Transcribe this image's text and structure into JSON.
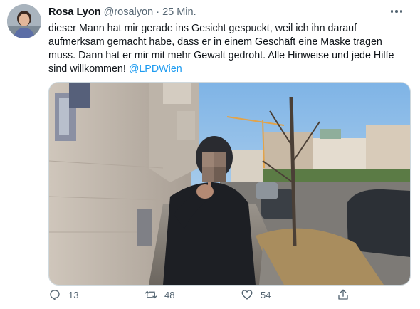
{
  "tweet": {
    "author_name": "Rosa Lyon",
    "handle": "@rosalyon",
    "separator": "·",
    "time": "25 Min.",
    "text": "dieser Mann hat mir gerade ins Gesicht gespuckt, weil ich ihn darauf aufmerksam gemacht habe, dass er in einem Geschäft eine Maske tragen muss. Dann hat er mir mit mehr Gewalt gedroht. Alle Hinweise und jede Hilfe sind willkommen!",
    "mention": "@LPDWien"
  },
  "actions": {
    "replies": "13",
    "retweets": "48",
    "likes": "54"
  },
  "colors": {
    "accent": "#1d9bf0",
    "muted": "#536471",
    "text": "#0f1419"
  },
  "icons": [
    "more-icon",
    "reply-icon",
    "retweet-icon",
    "like-icon",
    "share-icon"
  ]
}
